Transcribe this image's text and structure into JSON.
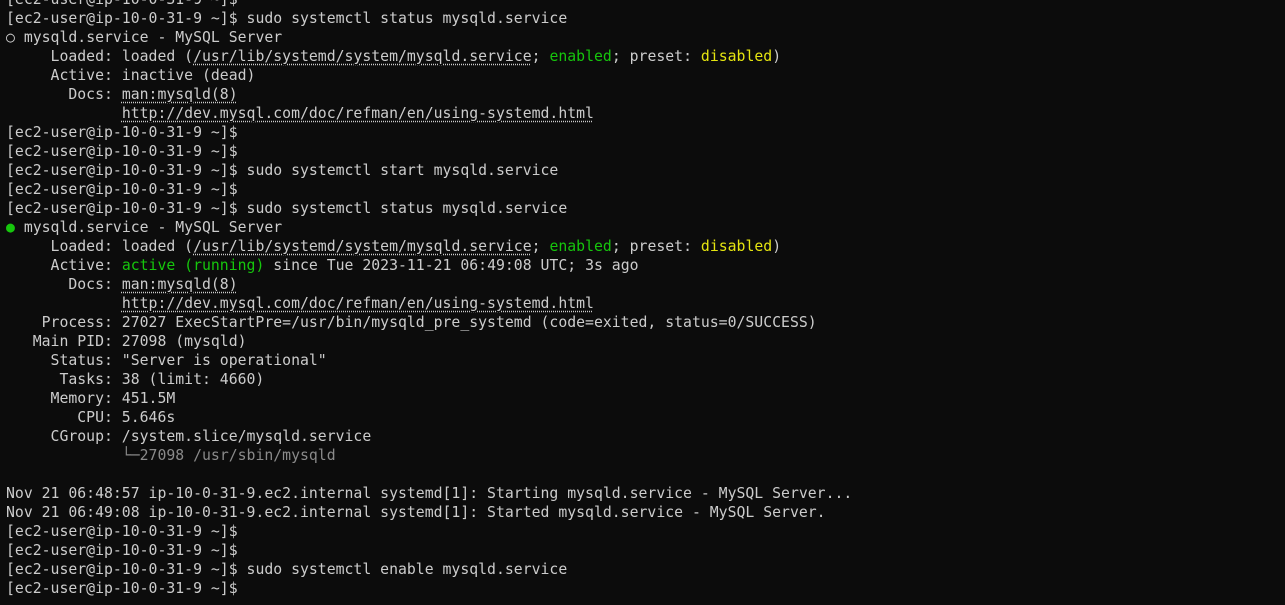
{
  "colors": {
    "background": "#0c0c0c",
    "text": "#cccccc",
    "green": "#16c60c",
    "yellow": "#e5e510",
    "gray": "#8a8a8a"
  },
  "prompt": "[ec2-user@ip-10-0-31-9 ~]$",
  "lines": [
    {
      "type": "prompt",
      "cmd": ""
    },
    {
      "type": "prompt",
      "cmd": " sudo systemctl status mysqld.service"
    },
    {
      "type": "unit-header",
      "bullet": "○",
      "bullet_state": "inactive",
      "text": " mysqld.service - MySQL Server"
    },
    {
      "type": "loaded",
      "label": "     Loaded: ",
      "pre": "loaded (",
      "path": "/usr/lib/systemd/system/mysqld.service",
      "mid": "; ",
      "enabled": "enabled",
      "mid2": "; preset: ",
      "preset": "disabled",
      "end": ")"
    },
    {
      "type": "plain",
      "text": "     Active: inactive (dead)"
    },
    {
      "type": "docs",
      "label": "       Docs: ",
      "link": "man:mysqld(8)"
    },
    {
      "type": "docs",
      "label": "             ",
      "link": "http://dev.mysql.com/doc/refman/en/using-systemd.html"
    },
    {
      "type": "prompt",
      "cmd": ""
    },
    {
      "type": "prompt",
      "cmd": ""
    },
    {
      "type": "prompt",
      "cmd": " sudo systemctl start mysqld.service"
    },
    {
      "type": "prompt",
      "cmd": ""
    },
    {
      "type": "prompt",
      "cmd": " sudo systemctl status mysqld.service"
    },
    {
      "type": "unit-header",
      "bullet": "●",
      "bullet_state": "active",
      "text": " mysqld.service - MySQL Server"
    },
    {
      "type": "loaded",
      "label": "     Loaded: ",
      "pre": "loaded (",
      "path": "/usr/lib/systemd/system/mysqld.service",
      "mid": "; ",
      "enabled": "enabled",
      "mid2": "; preset: ",
      "preset": "disabled",
      "end": ")"
    },
    {
      "type": "active",
      "label": "     Active: ",
      "state": "active (running)",
      "rest": " since Tue 2023-11-21 06:49:08 UTC; 3s ago"
    },
    {
      "type": "docs",
      "label": "       Docs: ",
      "link": "man:mysqld(8)"
    },
    {
      "type": "docs",
      "label": "             ",
      "link": "http://dev.mysql.com/doc/refman/en/using-systemd.html"
    },
    {
      "type": "plain",
      "text": "    Process: 27027 ExecStartPre=/usr/bin/mysqld_pre_systemd (code=exited, status=0/SUCCESS)"
    },
    {
      "type": "plain",
      "text": "   Main PID: 27098 (mysqld)"
    },
    {
      "type": "plain",
      "text": "     Status: \"Server is operational\""
    },
    {
      "type": "plain",
      "text": "      Tasks: 38 (limit: 4660)"
    },
    {
      "type": "plain",
      "text": "     Memory: 451.5M"
    },
    {
      "type": "plain",
      "text": "        CPU: 5.646s"
    },
    {
      "type": "plain",
      "text": "     CGroup: /system.slice/mysqld.service"
    },
    {
      "type": "cgroup-child",
      "indent": "             ",
      "branch": "└─",
      "text": "27098 /usr/sbin/mysqld"
    },
    {
      "type": "plain",
      "text": ""
    },
    {
      "type": "plain",
      "text": "Nov 21 06:48:57 ip-10-0-31-9.ec2.internal systemd[1]: Starting mysqld.service - MySQL Server..."
    },
    {
      "type": "plain",
      "text": "Nov 21 06:49:08 ip-10-0-31-9.ec2.internal systemd[1]: Started mysqld.service - MySQL Server."
    },
    {
      "type": "prompt",
      "cmd": ""
    },
    {
      "type": "prompt",
      "cmd": ""
    },
    {
      "type": "prompt",
      "cmd": " sudo systemctl enable mysqld.service"
    },
    {
      "type": "prompt",
      "cmd": ""
    }
  ]
}
